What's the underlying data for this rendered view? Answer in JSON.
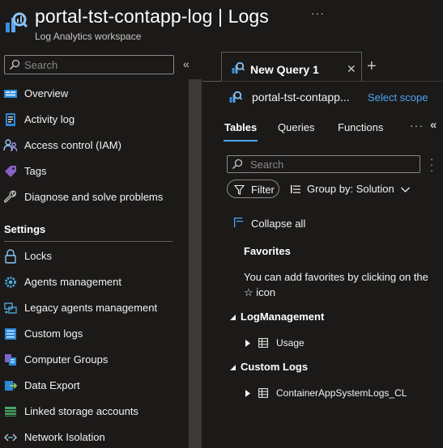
{
  "header": {
    "title": "portal-tst-contapp-log | Logs",
    "subtitle": "Log Analytics workspace",
    "more": "···"
  },
  "sidebar": {
    "search_placeholder": "Search",
    "collapse": "«",
    "items": [
      {
        "label": "Overview",
        "icon": "overview-icon"
      },
      {
        "label": "Activity log",
        "icon": "activity-log-icon"
      },
      {
        "label": "Access control (IAM)",
        "icon": "people-icon"
      },
      {
        "label": "Tags",
        "icon": "tag-icon"
      },
      {
        "label": "Diagnose and solve problems",
        "icon": "wrench-icon"
      }
    ],
    "settings_header": "Settings",
    "settings_items": [
      {
        "label": "Locks",
        "icon": "lock-icon"
      },
      {
        "label": "Agents management",
        "icon": "gear-icon"
      },
      {
        "label": "Legacy agents management",
        "icon": "legacy-agents-icon"
      },
      {
        "label": "Custom logs",
        "icon": "list-icon"
      },
      {
        "label": "Computer Groups",
        "icon": "computer-groups-icon"
      },
      {
        "label": "Data Export",
        "icon": "export-icon"
      },
      {
        "label": "Linked storage accounts",
        "icon": "storage-icon"
      },
      {
        "label": "Network Isolation",
        "icon": "network-icon"
      }
    ]
  },
  "main": {
    "query_tab": {
      "label": "New Query 1",
      "close": "✕"
    },
    "add_tab": "+",
    "scope": {
      "name": "portal-tst-contapp...",
      "link": "Select scope"
    },
    "panel_tabs": [
      "Tables",
      "Queries",
      "Functions"
    ],
    "active_tab": "Tables",
    "panel_more": "···",
    "panel_collapse": "«",
    "search_placeholder": "Search",
    "filter_label": "Filter",
    "group_by_label": "Group by: Solution",
    "collapse_all": "Collapse all",
    "favorites": {
      "title": "Favorites",
      "text": "You can add favorites by clicking on the ☆ icon"
    },
    "groups": [
      {
        "name": "LogManagement",
        "tables": [
          "Usage"
        ]
      },
      {
        "name": "Custom Logs",
        "tables": [
          "ContainerAppSystemLogs_CL"
        ]
      }
    ]
  },
  "colors": {
    "background": "#1b1a19",
    "accent": "#4fa3f7",
    "text": "#f3f2f1",
    "scrollbar": "#3b3a39"
  }
}
